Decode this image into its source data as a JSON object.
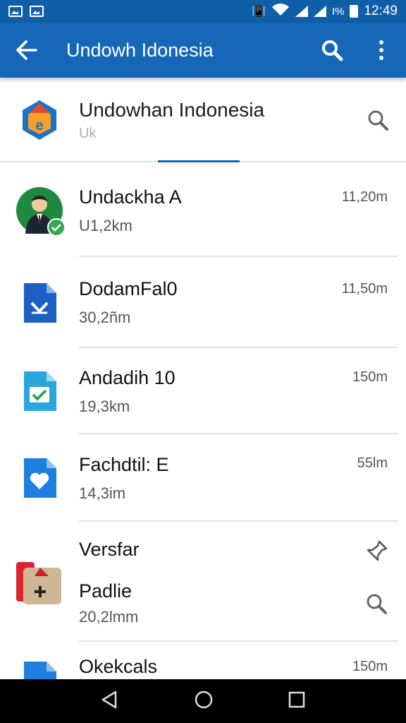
{
  "status_bar": {
    "time": "12:49",
    "battery_text": "I%",
    "left_icons": [
      "image-notification-icon",
      "photo-notification-icon"
    ],
    "right_icons": [
      "vibrate-icon",
      "wifi-icon",
      "signal-icon",
      "signal-icon",
      "battery-icon"
    ]
  },
  "app_bar": {
    "title": "Undowh Idonesia",
    "back_icon": "arrow-back-icon",
    "search_icon": "search-icon",
    "menu_icon": "more-vert-icon",
    "color": "#1667b8"
  },
  "header": {
    "title": "Undowhan Indonesia",
    "subtitle": "Uk",
    "logo_icon": "house-logo-icon",
    "search_icon": "search-icon"
  },
  "items": [
    {
      "title": "Undackha A",
      "subtitle": "U1,2km",
      "time": "11,20m",
      "icon": "avatar-icon"
    },
    {
      "title": "DodamFal0",
      "subtitle": "30,2ñm",
      "time": "11,50m",
      "icon": "download-doc-icon"
    },
    {
      "title": "Andadih 10",
      "subtitle": "19,3km",
      "time": "150m",
      "icon": "checked-doc-icon"
    },
    {
      "title": "Fachdtil: E",
      "subtitle": "14,3im",
      "time": "55lm",
      "icon": "heart-doc-icon"
    },
    {
      "title": "Versfar",
      "title2": "Padlie",
      "subtitle": "20,2lmm",
      "icon": "medical-box-icon",
      "action_top": "pin-icon",
      "action_bottom": "search-icon"
    },
    {
      "title": "Okekcals",
      "time": "150m",
      "icon": "folder-doc-icon"
    }
  ],
  "nav": {
    "back": "nav-back-icon",
    "home": "nav-home-icon",
    "recents": "nav-recents-icon"
  }
}
